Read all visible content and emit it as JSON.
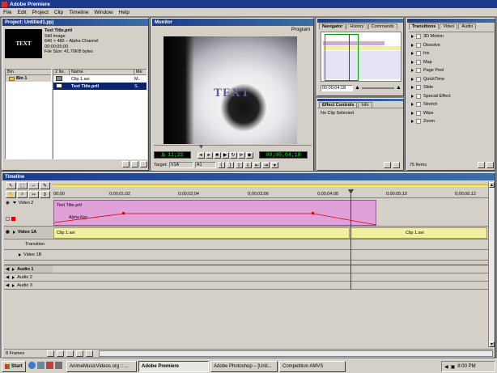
{
  "app": {
    "title": "Adobe Premiere"
  },
  "menu": [
    "File",
    "Edit",
    "Project",
    "Clip",
    "Timeline",
    "Window",
    "Help"
  ],
  "project": {
    "title": "Project: Untitled1.ppj",
    "thumb_text": "TEXT",
    "clip_name": "Text Title.prtl",
    "info": [
      "Still Image",
      "640 × 480 – Alpha Channel",
      "00;00;05;00",
      "File Size: 41.70KB bytes"
    ],
    "bin_header": "Bin",
    "bins": [
      "Bin 1"
    ],
    "col_headers": [
      "2 Ite..",
      "Name",
      "Me"
    ],
    "items": [
      {
        "name": "Clip 1.avi",
        "media": "M..",
        "selected": false
      },
      {
        "name": "Text Title.prtl",
        "media": "S.",
        "selected": true
      }
    ]
  },
  "monitor": {
    "title": "Monitor",
    "label": "Program",
    "overlay_text": "TEXT",
    "timecode_left": "Δ 11;22",
    "timecode_right": "00;00;04;18",
    "target_label": "Target:",
    "target_value": "V1A",
    "audio_value": "A1"
  },
  "navigator": {
    "tabs": [
      "Navigator",
      "History",
      "Commands"
    ],
    "timecode": "00;00;04;18"
  },
  "effect_controls": {
    "tabs": [
      "Effect Controls",
      "Info"
    ],
    "message": "No Clip Selected"
  },
  "transitions": {
    "tabs": [
      "Transitions",
      "Video",
      "Audio"
    ],
    "items": [
      "3D Motion",
      "Dissolve",
      "Iris",
      "Map",
      "Page Peel",
      "QuickTime",
      "Slide",
      "Special Effect",
      "Stretch",
      "Wipe",
      "Zoom"
    ],
    "count": "75 Items"
  },
  "timeline": {
    "title": "Timeline",
    "ruler_labels": [
      "00;00",
      "0;00;01;02",
      "0;00;02;04",
      "0;00;03;06",
      "0;00;04;08",
      "0;00;05;10",
      "0;00;06;12"
    ],
    "tracks": {
      "video2": "Video 2",
      "video1a": "Video 1A",
      "transition": "Transition",
      "video1b": "Video 1B",
      "audio1": "Audio 1",
      "audio2": "Audio 2",
      "audio3": "Audio 3"
    },
    "clip_title": "Text Title.prtl",
    "clip_sub": "Alpha Key",
    "clip1_a": "Clip 1.avi",
    "clip1_b": "Clip 1.avi",
    "frames": "8 Frames"
  },
  "taskbar": {
    "start": "Start",
    "tasks": [
      "AnimeMusicVideos.org :: ...",
      "Adobe Premiere",
      "Adobe Photoshop – [Unti...",
      "Competition AMVS"
    ],
    "clock": "8:00 PM"
  }
}
